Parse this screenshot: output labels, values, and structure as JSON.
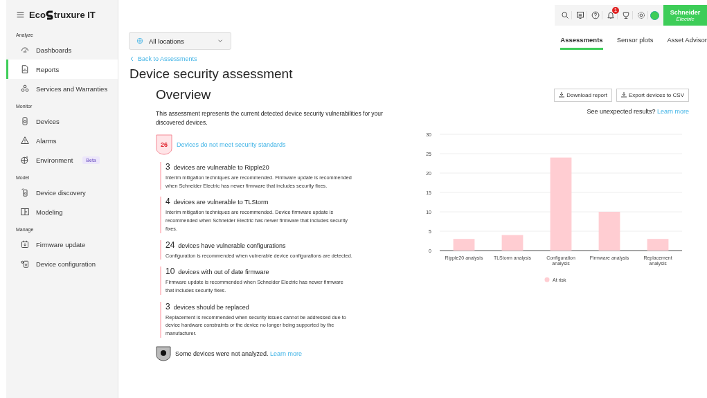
{
  "logo": {
    "left": "Eco",
    "right": "truxure IT"
  },
  "sidebar": {
    "sections": [
      {
        "label": "Analyze",
        "items": [
          {
            "label": "Dashboards",
            "selected": false
          },
          {
            "label": "Reports",
            "selected": true
          },
          {
            "label": "Services and Warranties",
            "selected": false
          }
        ]
      },
      {
        "label": "Monitor",
        "items": [
          {
            "label": "Devices",
            "selected": false
          },
          {
            "label": "Alarms",
            "selected": false
          },
          {
            "label": "Environment",
            "selected": false,
            "badge": "Beta"
          }
        ]
      },
      {
        "label": "Model",
        "items": [
          {
            "label": "Device discovery",
            "selected": false
          },
          {
            "label": "Modeling",
            "selected": false
          }
        ]
      },
      {
        "label": "Manage",
        "items": [
          {
            "label": "Firmware update",
            "selected": false
          },
          {
            "label": "Device configuration",
            "selected": false
          }
        ]
      }
    ]
  },
  "toolbar": {
    "notification_count": "1",
    "brand": {
      "name": "Schneider",
      "sub": "Electric"
    }
  },
  "location_select": {
    "value": "All locations"
  },
  "tabs": [
    {
      "label": "Assessments",
      "selected": true
    },
    {
      "label": "Sensor plots",
      "selected": false
    },
    {
      "label": "Asset Advisor",
      "selected": false
    }
  ],
  "back_link": "Back to Assessments",
  "title": "Device security assessment",
  "overview": {
    "heading": "Overview",
    "buttons": [
      "Download report",
      "Export devices to CSV"
    ],
    "description": "This assessment represents the current detected device security vulnerabilities for your discovered devices.",
    "unexpected": {
      "text": "See unexpected results?",
      "link": "Learn more"
    },
    "summary": {
      "count": "26",
      "text": "Devices do not meet security standards"
    },
    "findings": [
      {
        "count": "3",
        "title": "devices are vulnerable to Ripple20",
        "description": "Interim mitigation techniques are recommended. Firmware update is recommended when Schneider Electric has newer firmware that includes security fixes."
      },
      {
        "count": "4",
        "title": "devices are vulnerable to TLStorm",
        "description": "Interim mitigation techniques are recommended. Device firmware update is recommended when Schneider Electric has newer firmware that includes security fixes."
      },
      {
        "count": "24",
        "title": "devices have vulnerable configurations",
        "description": "Configuration is recommended when vulnerable device configurations are detected."
      },
      {
        "count": "10",
        "title": "devices with out of date firmware",
        "description": "Firmware update is recommended when Schneider Electric has newer firmware that includes security fixes."
      },
      {
        "count": "3",
        "title": "devices should be replaced",
        "description": "Replacement is recommended when security issues cannot be addressed due to device hardware constraints or the device no longer being supported by the manufacturer."
      }
    ],
    "not_analyzed": {
      "text": "Some devices were not analyzed.",
      "link": "Learn more"
    },
    "chart_data": {
      "type": "bar",
      "categories": [
        "Ripple20 analysis",
        "TLStorm analysis",
        "Configuration analysis",
        "Firmware analysis",
        "Replacement analysis"
      ],
      "series": [
        {
          "name": "At risk",
          "color": "#ffcdd2",
          "values": [
            3,
            4,
            24,
            10,
            3
          ]
        }
      ],
      "grid": true,
      "ylim": [
        0,
        30
      ],
      "yticks": [
        0,
        5,
        10,
        15,
        20,
        25,
        30
      ]
    }
  }
}
